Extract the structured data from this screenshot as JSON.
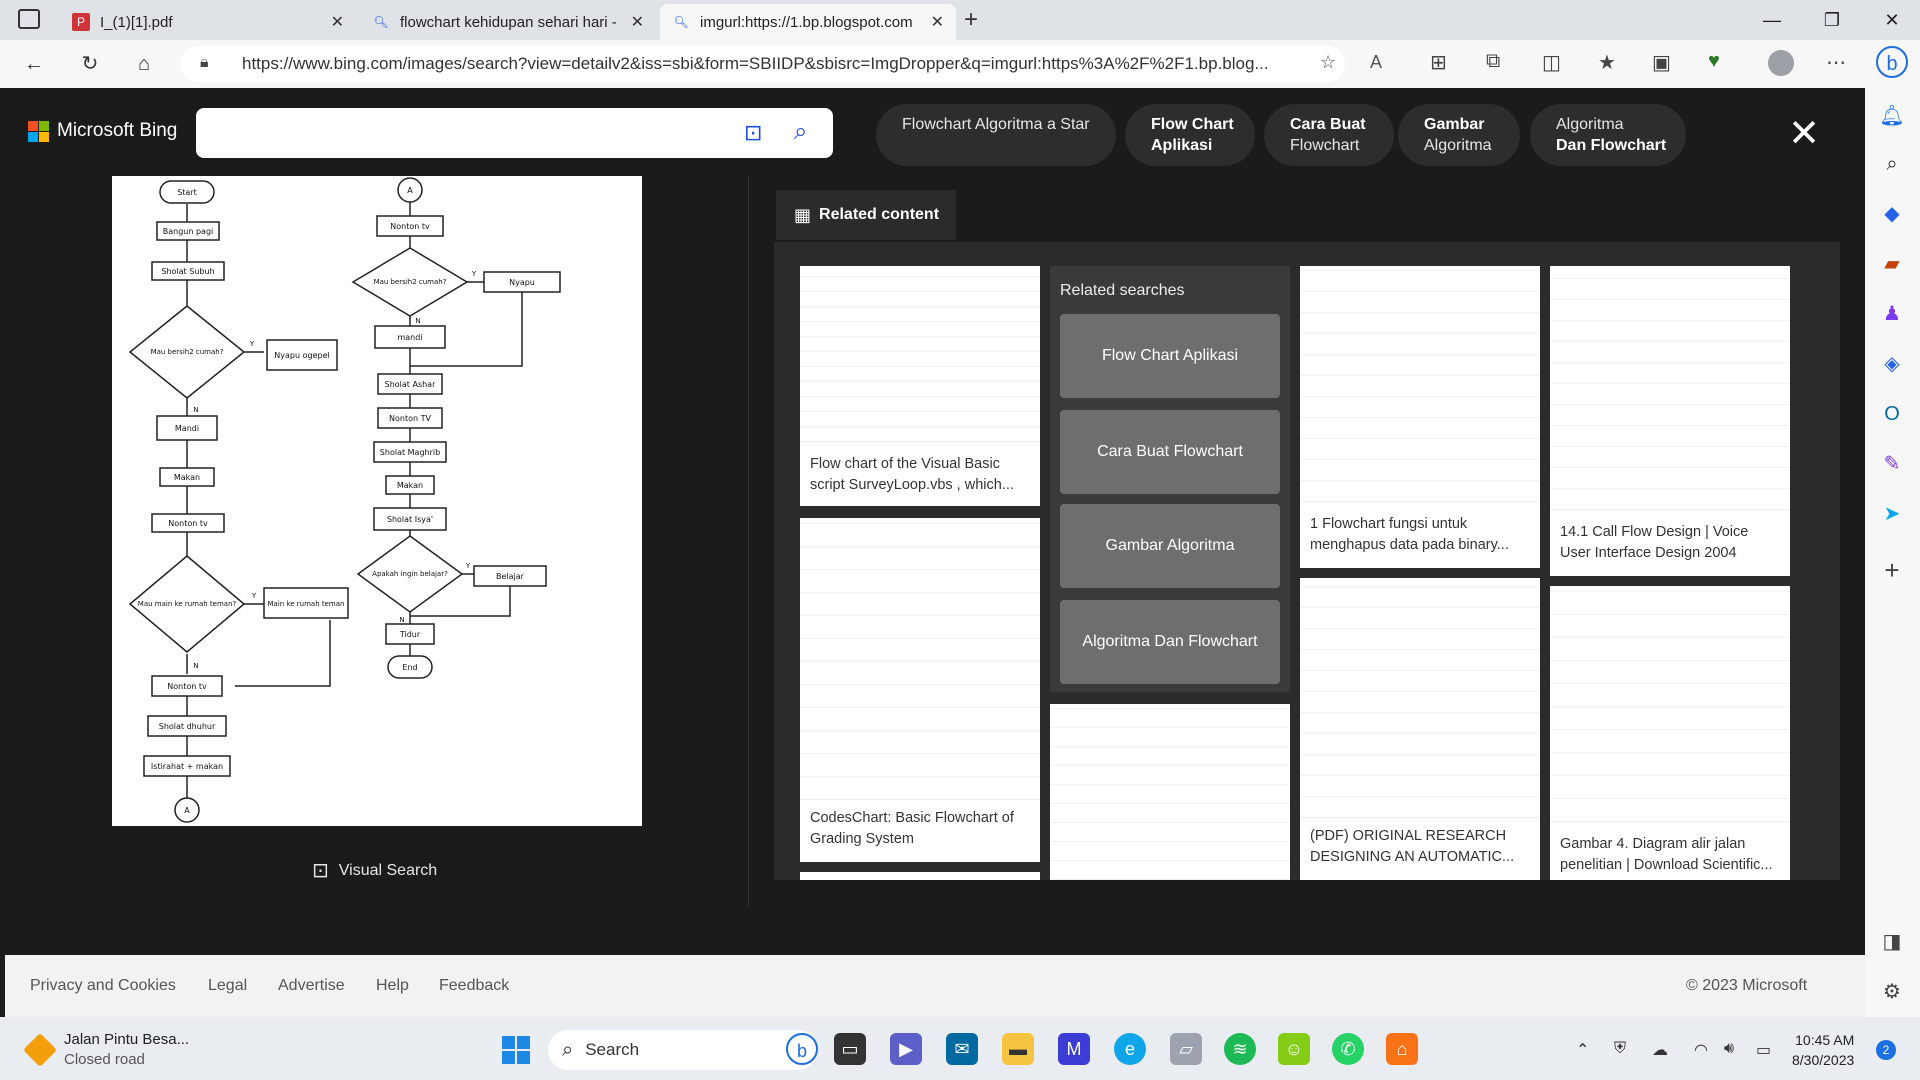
{
  "browser": {
    "tabs": [
      {
        "label": "I_(1)[1].pdf",
        "icon": "pdf-icon"
      },
      {
        "label": "flowchart kehidupan sehari hari -",
        "icon": "search-icon"
      },
      {
        "label": "imgurl:https://1.bp.blogspot.com",
        "icon": "search-icon"
      }
    ],
    "url": "https://www.bing.com/images/search?view=detailv2&iss=sbi&form=SBIIDP&sbisrc=ImgDropper&q=imgurl:https%3A%2F%2F1.bp.blog..."
  },
  "bing": {
    "logo": "Microsoft Bing",
    "chips": [
      {
        "line1": "Flowchart Algoritma a Star",
        "line2": ""
      },
      {
        "line1": "Flow Chart",
        "line2": "Aplikasi"
      },
      {
        "line1": "Cara Buat",
        "line2": "Flowchart"
      },
      {
        "line1": "Gambar",
        "line2": "Algoritma"
      },
      {
        "line1": "Algoritma",
        "line2": "Dan Flowchart"
      }
    ],
    "visual_search": "Visual Search",
    "related_tab": "Related content",
    "related_searches_label": "Related searches",
    "related_searches": [
      "Flow Chart Aplikasi",
      "Cara Buat Flowchart",
      "Gambar Algoritma",
      "Algoritma Dan Flowchart"
    ],
    "cards": [
      {
        "caption": "Flow chart of the Visual Basic script SurveyLoop.vbs , which..."
      },
      {
        "caption": "CodesChart: Basic Flowchart of Grading System"
      },
      {
        "caption": "1 Flowchart fungsi untuk menghapus data pada binary..."
      },
      {
        "caption": "(PDF) ORIGINAL RESEARCH DESIGNING AN AUTOMATIC..."
      },
      {
        "caption": "14.1 Call Flow Design | Voice User Interface Design 2004"
      },
      {
        "caption": "Gambar 4. Diagram alir jalan penelitian | Download Scientific..."
      }
    ]
  },
  "flowchart": {
    "left": [
      "Start",
      "Bangun pagi",
      "Sholat Subuh",
      "Mau bersih2 cumah?",
      "Nyapu ogepel",
      "Mandi",
      "Makan",
      "Nonton tv",
      "Mau main ke rumah teman?",
      "Main ke rumah teman",
      "Nonton tv",
      "Sholat dhuhur",
      "Istirahat + makan",
      "A"
    ],
    "right": [
      "A",
      "Nonton tv",
      "Mau bersih2 cumah?",
      "Nyapu",
      "mandi",
      "Sholat Ashar",
      "Nonton TV",
      "Sholat Maghrib",
      "Makan",
      "Sholat Isya'",
      "Apakah ingin belajar?",
      "Belajar",
      "Tidur",
      "End"
    ],
    "yes": "Y",
    "no": "N"
  },
  "footer": {
    "links": [
      "Privacy and Cookies",
      "Legal",
      "Advertise",
      "Help",
      "Feedback"
    ],
    "copyright": "© 2023 Microsoft"
  },
  "taskbar": {
    "weather_title": "Jalan Pintu Besa...",
    "weather_sub": "Closed road",
    "search": "Search",
    "time": "10:45 AM",
    "date": "8/30/2023",
    "badge": "2"
  }
}
